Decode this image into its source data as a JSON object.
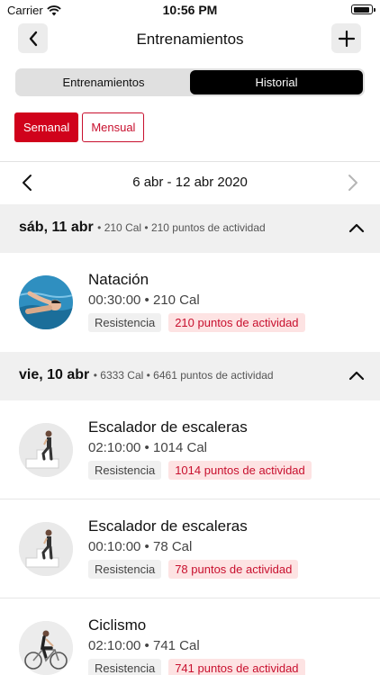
{
  "status": {
    "carrier": "Carrier",
    "time": "10:56 PM"
  },
  "nav": {
    "title": "Entrenamientos"
  },
  "segments": [
    {
      "label": "Entrenamientos",
      "selected": false
    },
    {
      "label": "Historial",
      "selected": true
    }
  ],
  "period": {
    "weekly": "Semanal",
    "monthly": "Mensual",
    "selected": "Semanal"
  },
  "date_range": "6 abr - 12 abr 2020",
  "days": [
    {
      "title": "sáb, 11 abr",
      "summary": "• 210 Cal • 210 puntos de actividad",
      "workouts": [
        {
          "name": "Natación",
          "meta": "00:30:00 • 210 Cal",
          "category": "Resistencia",
          "points": "210 puntos de actividad",
          "icon": "swimmer-avatar"
        }
      ]
    },
    {
      "title": "vie, 10 abr",
      "summary": "• 6333 Cal • 6461 puntos de actividad",
      "workouts": [
        {
          "name": "Escalador de escaleras",
          "meta": "02:10:00 • 1014 Cal",
          "category": "Resistencia",
          "points": "1014 puntos de actividad",
          "icon": "stair-climber-avatar"
        },
        {
          "name": "Escalador de escaleras",
          "meta": "00:10:00 • 78 Cal",
          "category": "Resistencia",
          "points": "78 puntos de actividad",
          "icon": "stair-climber-avatar"
        },
        {
          "name": "Ciclismo",
          "meta": "02:10:00 • 741 Cal",
          "category": "Resistencia",
          "points": "741 puntos de actividad",
          "icon": "cyclist-avatar"
        }
      ]
    }
  ],
  "colors": {
    "accent_red": "#d0021b",
    "tag_red_bg": "#fde3e3",
    "section_bg": "#f0f0f0"
  }
}
